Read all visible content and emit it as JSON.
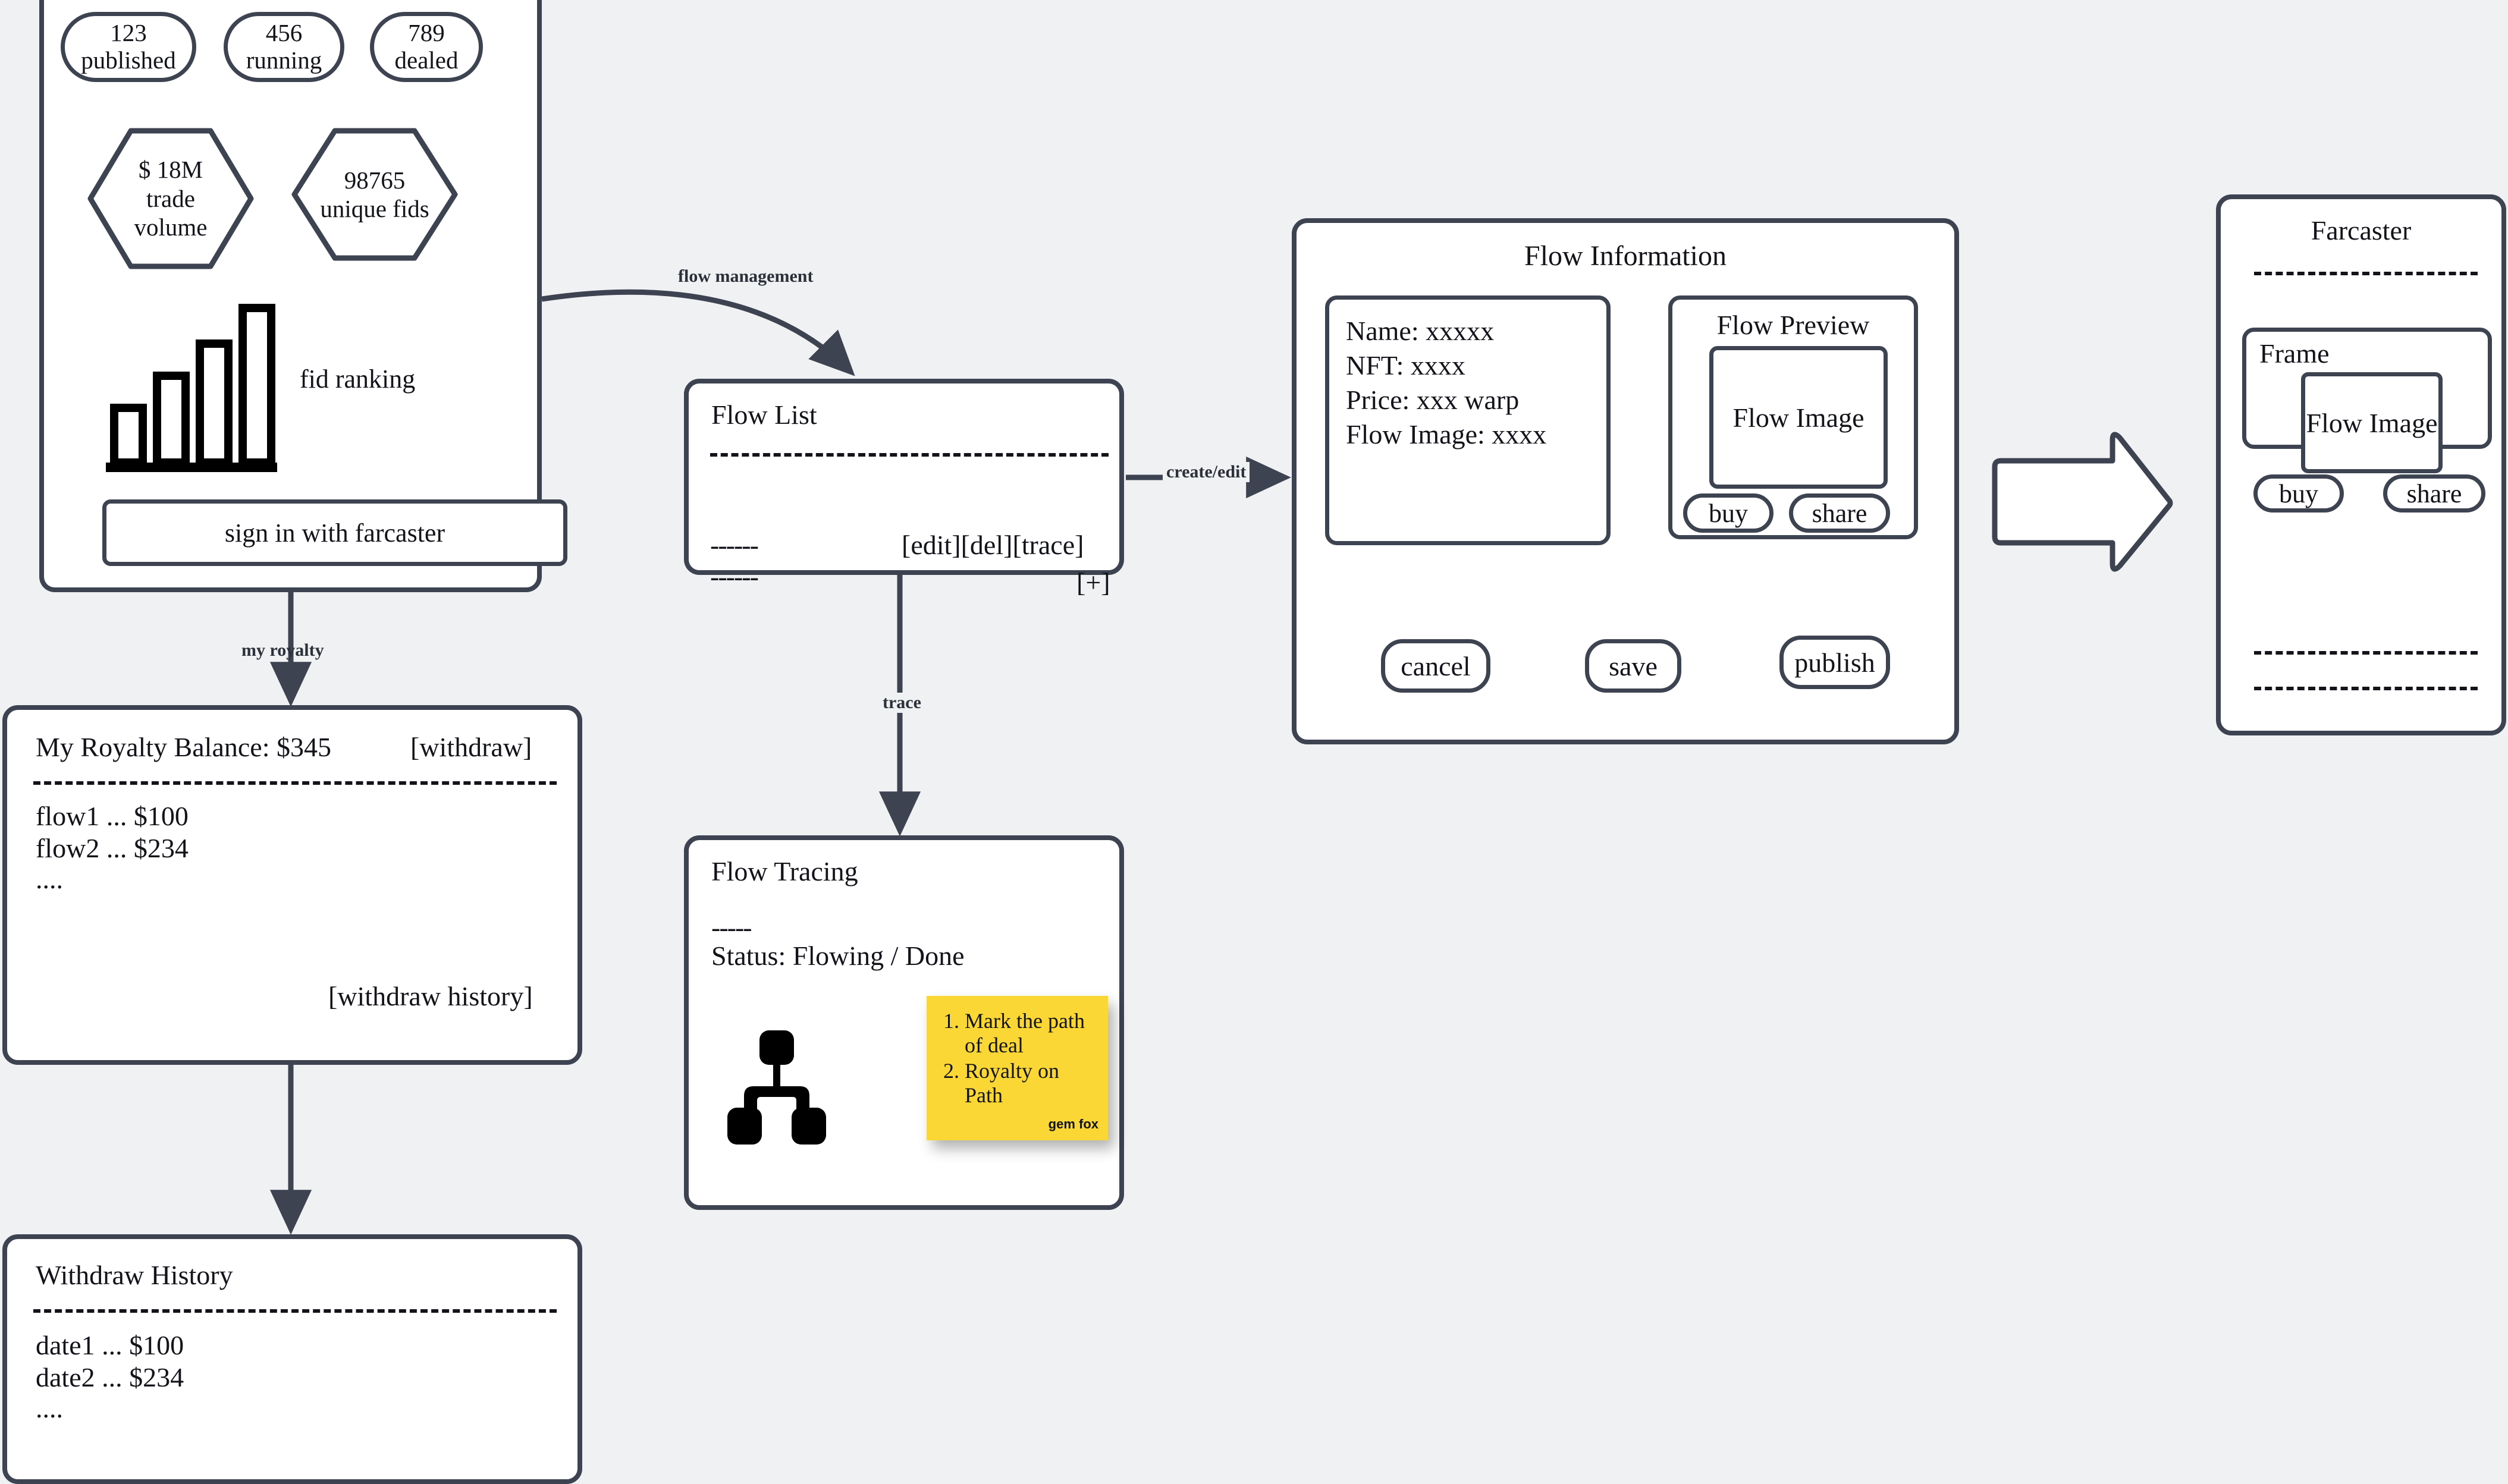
{
  "dashboard": {
    "stats": [
      {
        "value": "123",
        "label": "published"
      },
      {
        "value": "456",
        "label": "running"
      },
      {
        "value": "789",
        "label": "dealed"
      }
    ],
    "hexes": [
      {
        "text": "$ 18M\ntrade\nvolume"
      },
      {
        "text": "98765\nunique fids"
      }
    ],
    "ranking_label": "fid ranking",
    "chart_icon": "bar-chart-icon",
    "signin_label": "sign in with farcaster"
  },
  "royalty": {
    "heading": "My Royalty Balance: $345",
    "withdraw_label": "[withdraw]",
    "rows": [
      "flow1 ... $100",
      "flow2 ... $234",
      "...."
    ],
    "history_link": "[withdraw history]"
  },
  "withdraw_history": {
    "title": "Withdraw History",
    "rows": [
      "date1 ... $100",
      "date2 ... $234",
      "...."
    ]
  },
  "flow_list": {
    "title": "Flow List",
    "item1_stub": "------",
    "item2_stub": "------",
    "actions": "[edit][del][trace]",
    "add_label": "[+]"
  },
  "flow_tracing": {
    "title": "Flow Tracing",
    "divider": "-----",
    "status": "Status: Flowing / Done",
    "icon": "org-chart-icon",
    "note": {
      "items": [
        "Mark the path of deal",
        "Royalty on Path"
      ],
      "signature": "gem fox",
      "color": "#fbd735"
    }
  },
  "flow_information": {
    "title": "Flow Information",
    "fields": [
      "Name: xxxxx",
      "NFT: xxxx",
      "Price: xxx warp",
      "Flow Image: xxxx"
    ],
    "preview": {
      "title": "Flow Preview",
      "image_label": "Flow Image",
      "buttons": [
        "buy",
        "share"
      ]
    },
    "actions": [
      "cancel",
      "save",
      "publish"
    ]
  },
  "farcaster": {
    "title": "Farcaster",
    "frame": {
      "label": "Frame",
      "image_label": "Flow Image",
      "buttons": [
        "buy",
        "share"
      ]
    }
  },
  "edges": [
    {
      "label": "flow management"
    },
    {
      "label": "my royalty"
    },
    {
      "label": "create/edit"
    },
    {
      "label": "trace"
    }
  ],
  "colors": {
    "stroke": "#3d4350",
    "background": "#f0f1f3",
    "panel": "#ffffff",
    "note": "#fbd735"
  }
}
